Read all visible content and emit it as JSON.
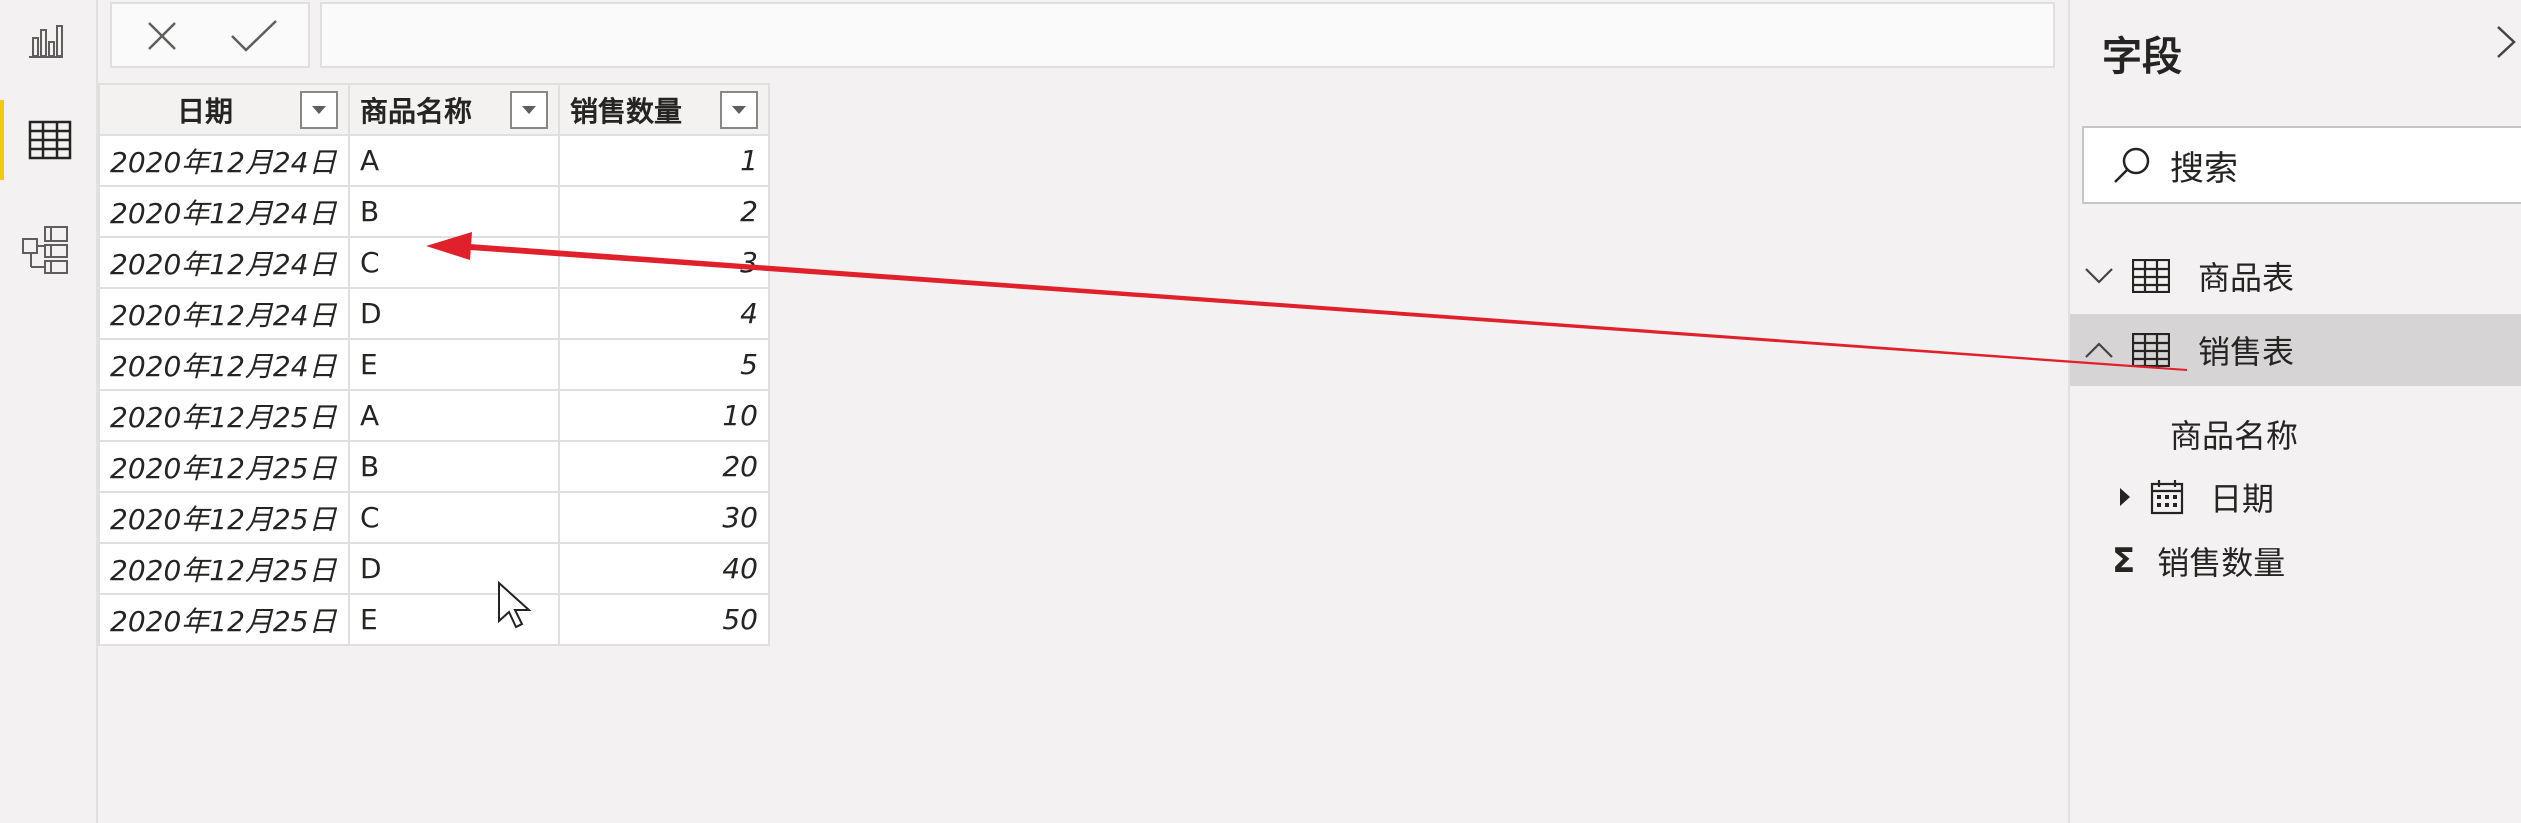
{
  "table": {
    "headers": [
      "日期",
      "商品名称",
      "销售数量"
    ],
    "rows": [
      {
        "date": "2020年12月24日",
        "name": "A",
        "qty": "1"
      },
      {
        "date": "2020年12月24日",
        "name": "B",
        "qty": "2"
      },
      {
        "date": "2020年12月24日",
        "name": "C",
        "qty": "3"
      },
      {
        "date": "2020年12月24日",
        "name": "D",
        "qty": "4"
      },
      {
        "date": "2020年12月24日",
        "name": "E",
        "qty": "5"
      },
      {
        "date": "2020年12月25日",
        "name": "A",
        "qty": "10"
      },
      {
        "date": "2020年12月25日",
        "name": "B",
        "qty": "20"
      },
      {
        "date": "2020年12月25日",
        "name": "C",
        "qty": "30"
      },
      {
        "date": "2020年12月25日",
        "name": "D",
        "qty": "40"
      },
      {
        "date": "2020年12月25日",
        "name": "E",
        "qty": "50"
      }
    ]
  },
  "fields_pane": {
    "title": "字段",
    "search_placeholder": "搜索",
    "tables": [
      {
        "name": "商品表",
        "expanded": false
      },
      {
        "name": "销售表",
        "expanded": true,
        "selected": true
      }
    ],
    "fields": [
      "商品名称",
      "日期",
      "销售数量"
    ]
  },
  "colors": {
    "accent": "#f2c811",
    "arrow": "#e0202a",
    "selected_row": "#d6d4d4"
  }
}
